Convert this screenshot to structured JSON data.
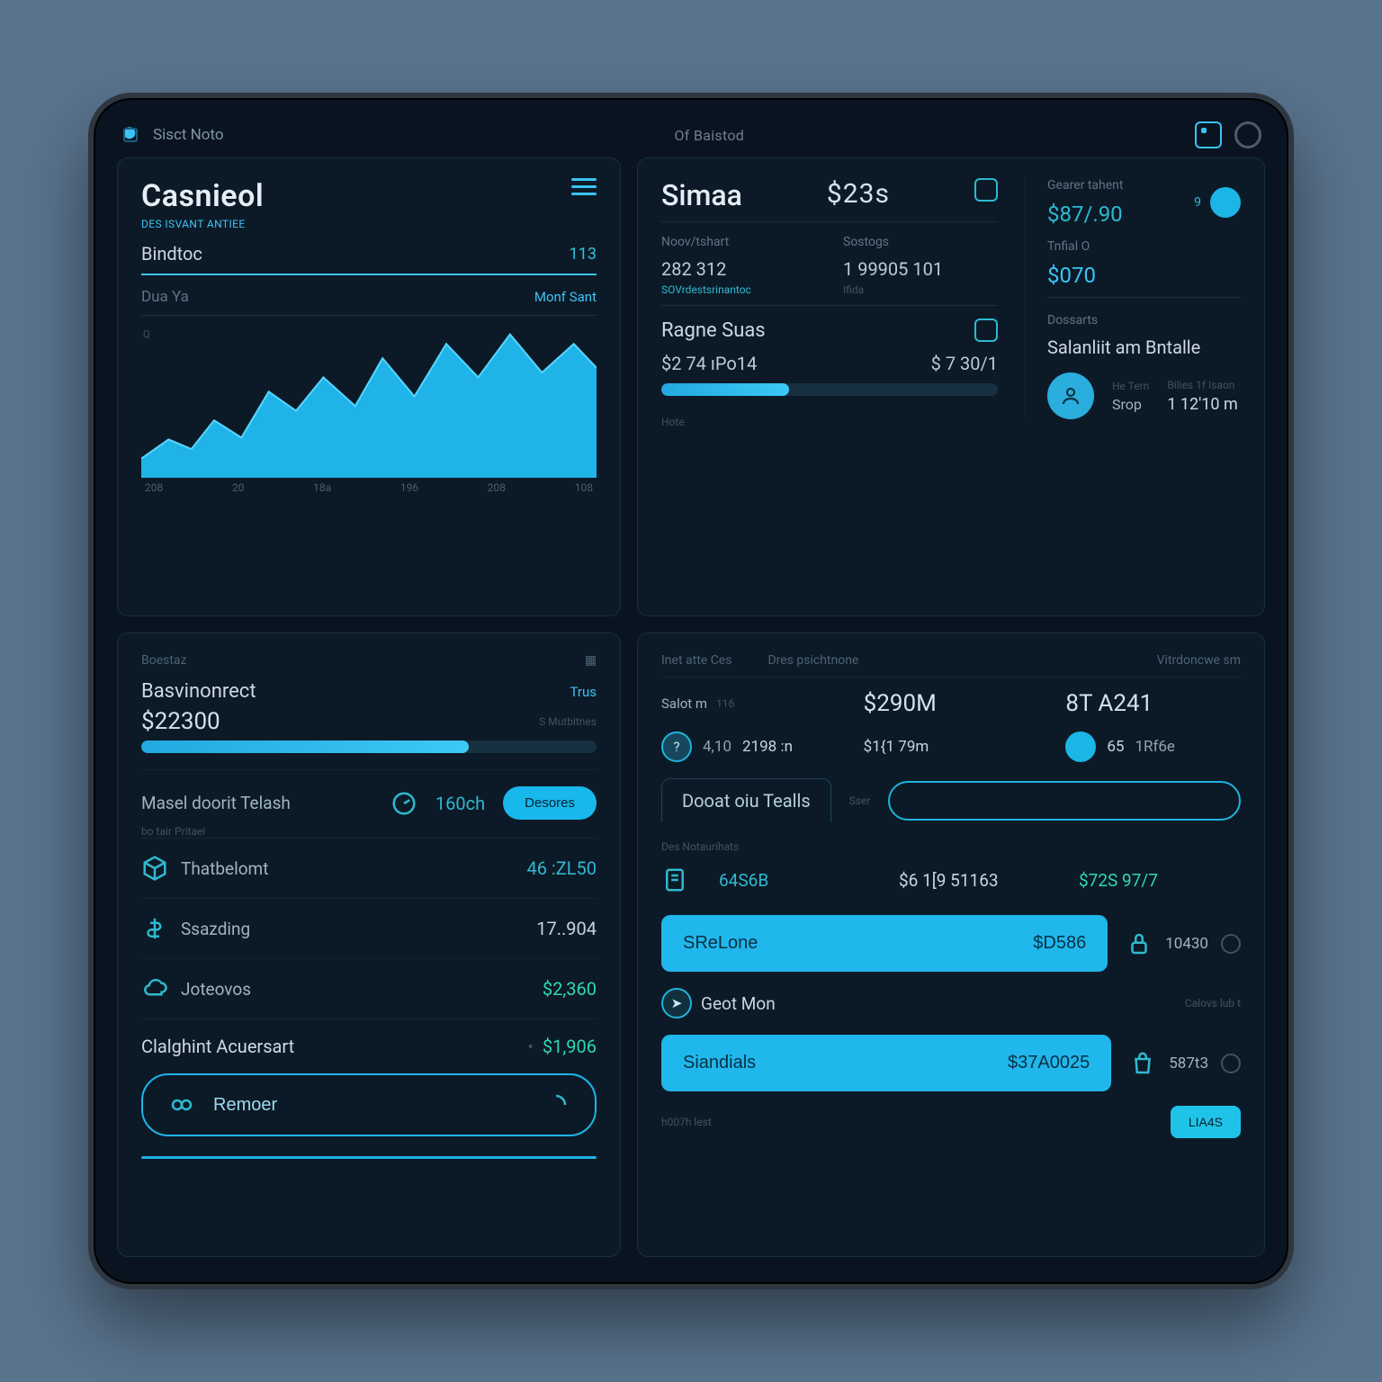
{
  "topbar": {
    "left": "Sisct Noto",
    "center": "Of Baistod",
    "sq": "window-icon",
    "circ": "power-icon"
  },
  "tl": {
    "brand": "Casnieol",
    "brand_sub": "DES ISVANT ANTIEE",
    "menu": "menu-icon",
    "row1_label": "Bindtoc",
    "row1_val": "113",
    "row2_label": "Dua Ya",
    "row2_val": "Monf Sant",
    "chart_q": "Q",
    "xticks": [
      "208",
      "20",
      "18a",
      "196",
      "208",
      "108"
    ]
  },
  "tr": {
    "title": "Simaa",
    "big": "$23s",
    "icon_a": "spark-icon",
    "dot": "9",
    "c1_label": "Noov/tshart",
    "c1_val": "282 312",
    "c1_sub": "SOVrdestsrinantoc",
    "c2_label": "Sostogs",
    "c2_val": "1 99905 101",
    "c2_sub": "Ifida",
    "c3_label": "Gearer tahent",
    "c3_val": "$87/.90",
    "c4_label": "Tnfial O",
    "c4_val": "$070",
    "range_lbl": "Ragne Suas",
    "range_val": "$2 74 ıPo14",
    "range_r": "$ 7 30/1",
    "range_sub": "Hote",
    "deposits": "Dossarts",
    "profile": "Salanliit am Bntalle",
    "p1_lbl": "He Tern",
    "p1_val": "Srop",
    "p2_lbl": "Bilies 1f Isaon",
    "p2_val": "1  12'10 m"
  },
  "bl": {
    "hdr_l": "Boestaz",
    "hdr_r": "□",
    "metric_lbl": "Basvinonrect",
    "metric_tab": "Trus",
    "metric_val": "$22300",
    "metric_note": "S Mutbitnes",
    "progress_pct": 72,
    "sec_lbl": "Masel doorit Telash",
    "sec_icon": "gauge-icon",
    "sec_val": "160ch",
    "sec_btn": "Desores",
    "sec_sub": "bo tair Pritaei",
    "items": [
      {
        "icon": "cube-icon",
        "label": "Thatbelomt",
        "val": "46 :ZL50"
      },
      {
        "icon": "dollar-icon",
        "label": "Ssazding",
        "val": "17..904"
      },
      {
        "icon": "cloud-icon",
        "label": "Joteovos",
        "val": "$2,360"
      }
    ],
    "acc_lbl": "Clalghint Acuersart",
    "acc_val": "$1,906",
    "cta": "Remoer"
  },
  "br": {
    "tabs": [
      "Inet atte Ces",
      "Dres psichtnone",
      "Vitrdoncwe sm"
    ],
    "s1_lbl": "Salot m",
    "s1_badge": "116",
    "s1_val": "$290M",
    "s2_val": "8T A241",
    "chips": [
      {
        "style": "outline",
        "badge": "?",
        "a": "4,10",
        "b": "2198 :n"
      },
      {
        "style": "plain",
        "a": "$1{1 79m"
      },
      {
        "style": "solid",
        "badge": "",
        "a": "65",
        "b": "1Rf6e"
      }
    ],
    "tab_active": "Dooat oiu Tealls",
    "tab_side": "Sser",
    "list_hdr": "Des Notauríhats",
    "row1": {
      "icon": "doc-icon",
      "a": "64S6B",
      "b": "$6 1[9 51163",
      "c": "$72S 97/7"
    },
    "btn1": {
      "label": "SReLone",
      "val": "$D586"
    },
    "side1": {
      "icon": "lock-icon",
      "val": "10430"
    },
    "btn2_icon": "arrow-icon",
    "btn2_lbl": "Geot Mon",
    "btn2_side": "Calovs lub t",
    "btn3": {
      "label": "Siandials",
      "val": "$37A0025"
    },
    "side3": {
      "icon": "bag-icon",
      "val": "587t3"
    },
    "foot_l": "h007h lest",
    "foot_btn": "LIA4S"
  },
  "chart_data": {
    "type": "area",
    "title": "",
    "xlabel": "",
    "ylabel": "",
    "categories": [
      "208",
      "20",
      "18a",
      "196",
      "208",
      "108"
    ],
    "values": [
      18,
      30,
      22,
      55,
      48,
      72,
      60,
      95,
      70,
      110,
      85
    ],
    "ylim": [
      0,
      120
    ]
  }
}
